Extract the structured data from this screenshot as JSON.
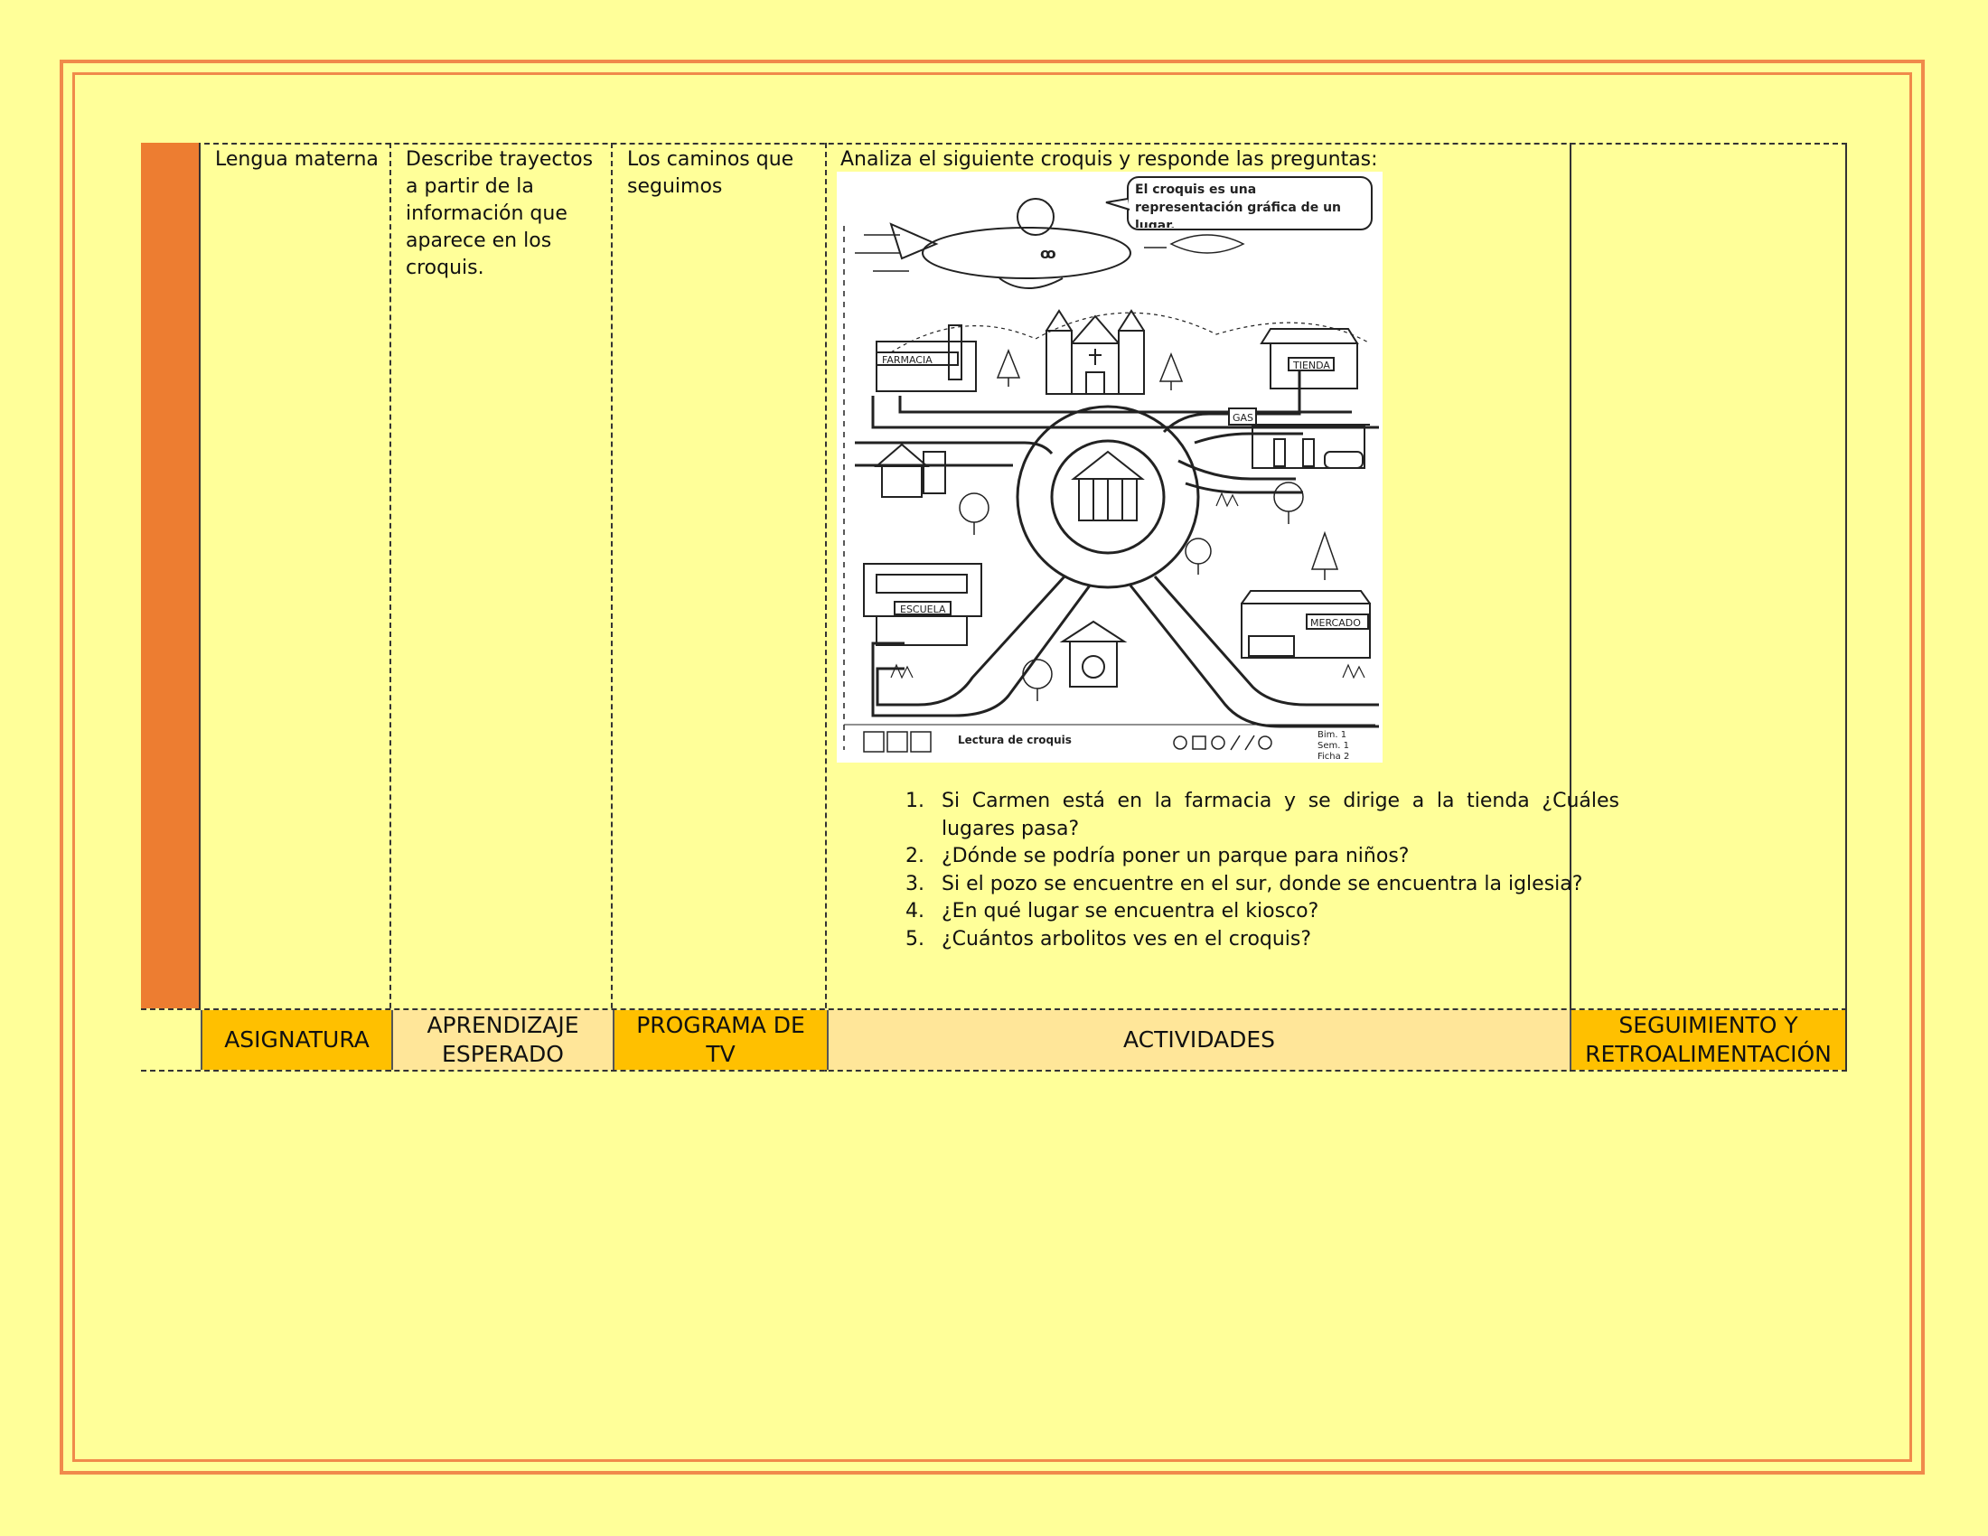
{
  "table": {
    "row": {
      "asignatura": "Lengua materna",
      "aprendizaje": "Describe trayectos a partir de la información que aparece en los croquis.",
      "programa": "Los caminos que seguimos",
      "actividades_intro": "Analiza el siguiente croquis y responde las preguntas:",
      "seguimiento": ""
    },
    "headers": {
      "asignatura": "ASIGNATURA",
      "aprendizaje": "APRENDIZAJE ESPERADO",
      "programa": "PROGRAMA DE TV",
      "actividades": "ACTIVIDADES",
      "seguimiento": "SEGUIMIENTO Y RETROALIMENTACIÓN"
    }
  },
  "croquis": {
    "speech": "El croquis es una representación gráfica de un lugar.",
    "labels": {
      "farmacia": "FARMACIA",
      "tienda": "TIENDA",
      "gas": "GAS",
      "escuela": "ESCUELA",
      "mercado": "MERCADO"
    },
    "footer_title": "Lectura de croquis",
    "footer_meta": [
      "Bim. 1",
      "Sem. 1",
      "Ficha 2"
    ]
  },
  "questions": [
    "Si Carmen está en la farmacia y se dirige a la tienda ¿Cuáles lugares pasa?",
    "¿Dónde se podría poner un parque para niños?",
    "Si el pozo se encuentre en el sur, donde se encuentra la iglesia?",
    "¿En qué lugar se encuentra el kiosco?",
    "¿Cuántos arbolitos ves en el croquis?"
  ],
  "colors": {
    "background": "#FFFF99",
    "frame": "#F08A4B",
    "side_bar": "#ED7D31",
    "header_dark": "#FFC000",
    "header_light": "#FFE699"
  }
}
